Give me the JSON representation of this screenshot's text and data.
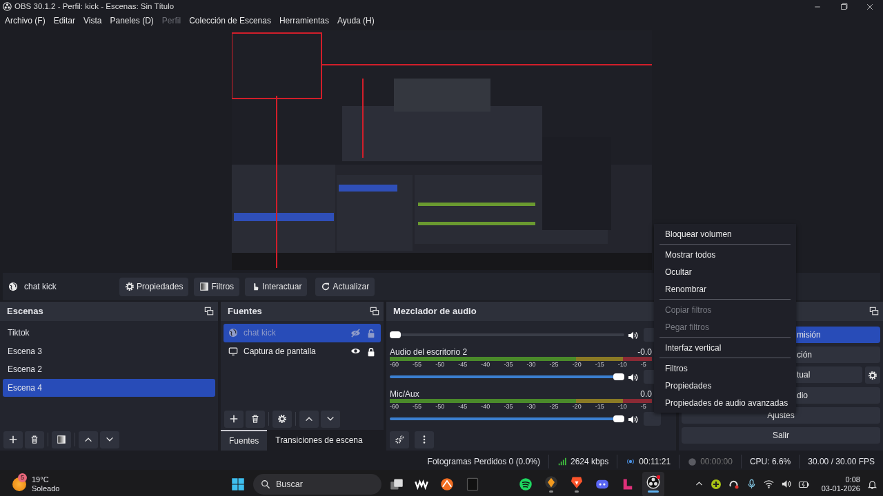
{
  "window": {
    "title": "OBS 30.1.2 - Perfil: kick - Escenas: Sin Título"
  },
  "menu": [
    {
      "label": "Archivo (F)",
      "disabled": false
    },
    {
      "label": "Editar",
      "disabled": false
    },
    {
      "label": "Vista",
      "disabled": false
    },
    {
      "label": "Paneles (D)",
      "disabled": false
    },
    {
      "label": "Perfil",
      "disabled": true
    },
    {
      "label": "Colección de Escenas",
      "disabled": false
    },
    {
      "label": "Herramientas",
      "disabled": false
    },
    {
      "label": "Ayuda (H)",
      "disabled": false
    }
  ],
  "context_bar": {
    "source": "chat kick",
    "buttons": [
      "Propiedades",
      "Filtros",
      "Interactuar",
      "Actualizar"
    ]
  },
  "scenes": {
    "title": "Escenas",
    "items": [
      {
        "label": "Tiktok",
        "selected": false
      },
      {
        "label": "Escena 3",
        "selected": false
      },
      {
        "label": "Escena 2",
        "selected": false
      },
      {
        "label": "Escena 4",
        "selected": true
      }
    ]
  },
  "sources": {
    "title": "Fuentes",
    "items": [
      {
        "label": "chat kick",
        "kind": "browser",
        "selected": true,
        "visible": false,
        "locked": false
      },
      {
        "label": "Captura de pantalla",
        "kind": "display",
        "selected": false,
        "visible": true,
        "locked": true
      }
    ],
    "tabs": [
      {
        "label": "Fuentes",
        "selected": true
      },
      {
        "label": "Transiciones de escena",
        "selected": false
      }
    ]
  },
  "mixer": {
    "title": "Mezclador de audio",
    "channels": [
      {
        "level": 0.0
      },
      {
        "name": "Audio del escritorio 2",
        "reading": "-0.0",
        "level": 1.0,
        "ticks": [
          "-60",
          "-55",
          "-50",
          "-45",
          "-40",
          "-35",
          "-30",
          "-25",
          "-20",
          "-15",
          "-10",
          "-5"
        ]
      },
      {
        "name": "Mic/Aux",
        "reading": "0.0",
        "level": 1.0,
        "ticks": [
          "-60",
          "-55",
          "-50",
          "-45",
          "-40",
          "-35",
          "-30",
          "-25",
          "-20",
          "-15",
          "-10",
          "-5"
        ]
      }
    ]
  },
  "controls": {
    "buttons": [
      {
        "label": "misión",
        "active": true
      },
      {
        "label": "ción",
        "active": false
      },
      {
        "label": "tual",
        "active": false
      },
      {
        "label": "dio",
        "active": false
      },
      {
        "label": "Ajustes",
        "active": false
      },
      {
        "label": "Salir",
        "active": false
      }
    ]
  },
  "context_menu": {
    "groups": [
      [
        {
          "label": "Bloquear volumen",
          "disabled": false
        }
      ],
      [
        {
          "label": "Mostrar todos",
          "disabled": false
        },
        {
          "label": "Ocultar",
          "disabled": false
        },
        {
          "label": "Renombrar",
          "disabled": false
        }
      ],
      [
        {
          "label": "Copiar filtros",
          "disabled": true
        },
        {
          "label": "Pegar filtros",
          "disabled": true
        }
      ],
      [
        {
          "label": "Interfaz vertical",
          "disabled": false
        }
      ],
      [
        {
          "label": "Filtros",
          "disabled": false
        },
        {
          "label": "Propiedades",
          "disabled": false
        },
        {
          "label": "Propiedades de audio avanzadas",
          "disabled": false
        }
      ]
    ]
  },
  "status_bar": {
    "dropped_frames": "Fotogramas Perdidos 0 (0.0%)",
    "bitrate": "2624 kbps",
    "streaming": true,
    "stream_time": "00:11:21",
    "recording": false,
    "record_time": "00:00:00",
    "cpu": "CPU: 6.6%",
    "fps": "30.00 / 30.00 FPS"
  },
  "taskbar": {
    "weather": {
      "badge": "5",
      "temperature": "19°C",
      "condition": "Soleado"
    },
    "search": {
      "placeholder": "Buscar"
    },
    "apps": [
      {
        "running": false,
        "active": false
      },
      {
        "running": false,
        "active": false
      },
      {
        "running": false,
        "active": false
      },
      {
        "running": false,
        "active": false
      },
      {
        "running": true,
        "active": false
      },
      {
        "running": true,
        "active": false
      },
      {
        "running": false,
        "active": false
      },
      {
        "running": false,
        "active": false
      },
      {
        "running": true,
        "active": true
      }
    ],
    "clock": {
      "time": "0:08",
      "date": "03-01-2026"
    }
  }
}
